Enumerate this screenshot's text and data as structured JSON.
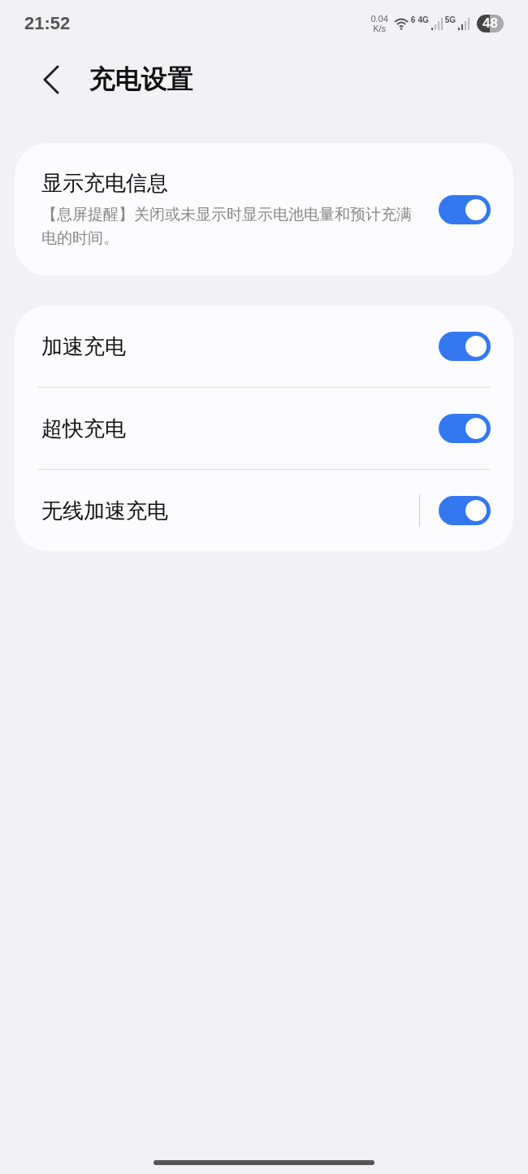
{
  "status_bar": {
    "time": "21:52",
    "speed_value": "0.04",
    "speed_unit": "K/s",
    "wifi_label": "6",
    "signal_1_label": "4G",
    "signal_2_label": "5G",
    "battery": "48"
  },
  "header": {
    "title": "充电设置"
  },
  "sections": [
    {
      "items": [
        {
          "kind": "switch",
          "label": "显示充电信息",
          "description": "【息屏提醒】关闭或未显示时显示电池电量和预计充满电的时间。",
          "on": true
        }
      ]
    },
    {
      "items": [
        {
          "kind": "switch",
          "label": "加速充电",
          "on": true
        },
        {
          "kind": "switch",
          "label": "超快充电",
          "on": true
        },
        {
          "kind": "split-switch",
          "label": "无线加速充电",
          "on": true
        }
      ]
    }
  ]
}
